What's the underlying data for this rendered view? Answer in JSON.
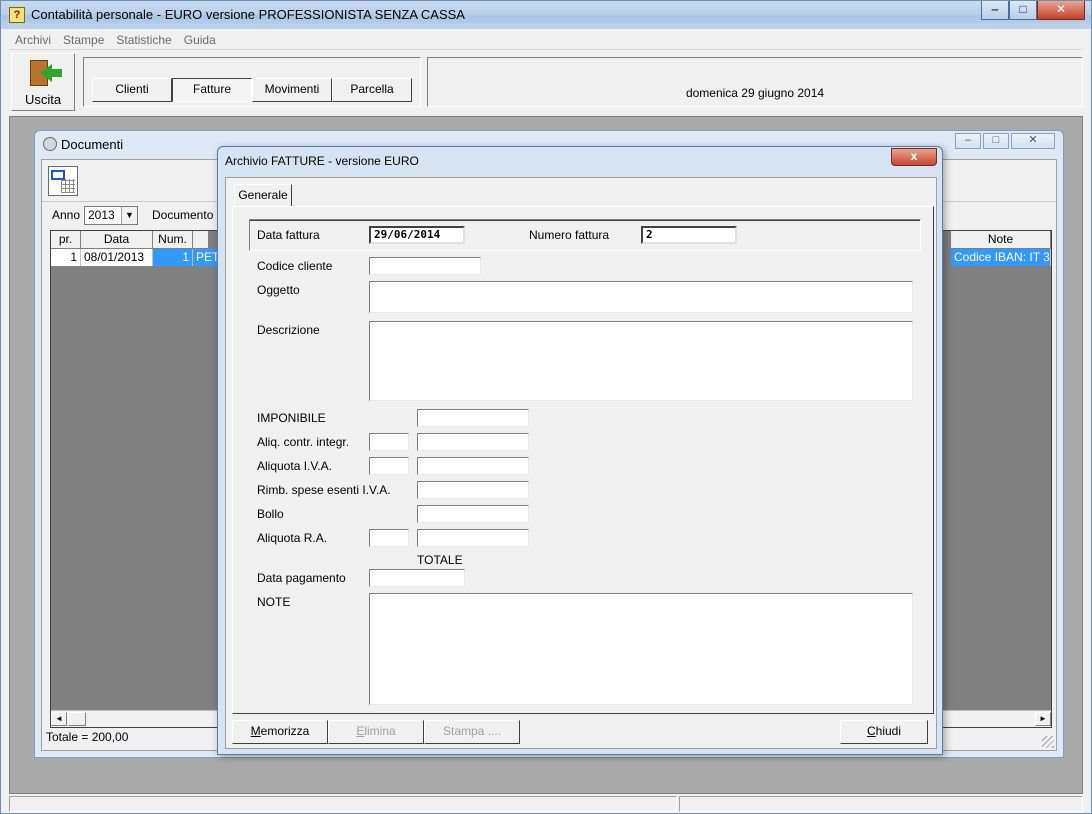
{
  "app": {
    "title": "Contabilità personale - EURO versione PROFESSIONISTA SENZA CASSA",
    "title_icon": "?"
  },
  "window_controls": {
    "minimize": "‒",
    "maximize": "□",
    "close": "✕"
  },
  "menu": [
    "Archivi",
    "Stampe",
    "Statistiche",
    "Guida"
  ],
  "toolbar": {
    "exit_label": "Uscita",
    "nav_buttons": [
      "Clienti",
      "Fatture",
      "Movimenti",
      "Parcella"
    ],
    "active_nav": "Fatture",
    "date_text": "domenica 29 giugno 2014"
  },
  "documenti": {
    "title": "Documenti",
    "anno_label": "Anno",
    "anno_value": "2013",
    "documento_label": "Documento",
    "columns": [
      "pr.",
      "Data",
      "Num.",
      "Note"
    ],
    "rows": [
      {
        "pr": "1",
        "data": "08/01/2013",
        "num": "1",
        "doc_partial": "PET",
        "note": "Codice IBAN: IT 3"
      }
    ],
    "total": "Totale = 200,00"
  },
  "dialog": {
    "title": "Archivio FATTURE - versione EURO",
    "close_label": "x",
    "tab_label": "Generale",
    "fields": {
      "data_fattura_label": "Data fattura",
      "data_fattura_value": "29/06/2014",
      "numero_fattura_label": "Numero fattura",
      "numero_fattura_value": "2",
      "codice_cliente_label": "Codice cliente",
      "oggetto_label": "Oggetto",
      "descrizione_label": "Descrizione",
      "imponibile_label": "IMPONIBILE",
      "aliq_contr_label": "Aliq. contr. integr.",
      "aliquota_iva_label": "Aliquota I.V.A.",
      "rimb_spese_label": "Rimb. spese esenti I.V.A.",
      "bollo_label": "Bollo",
      "aliquota_ra_label": "Aliquota R.A.",
      "totale_label": "TOTALE",
      "data_pagamento_label": "Data pagamento",
      "note_label": "NOTE"
    },
    "buttons": {
      "memorizza_u": "M",
      "memorizza_rest": "emorizza",
      "elimina_u": "E",
      "elimina_rest": "limina",
      "stampa": "Stampa ....",
      "chiudi_u": "C",
      "chiudi_rest": "hiudi"
    }
  }
}
